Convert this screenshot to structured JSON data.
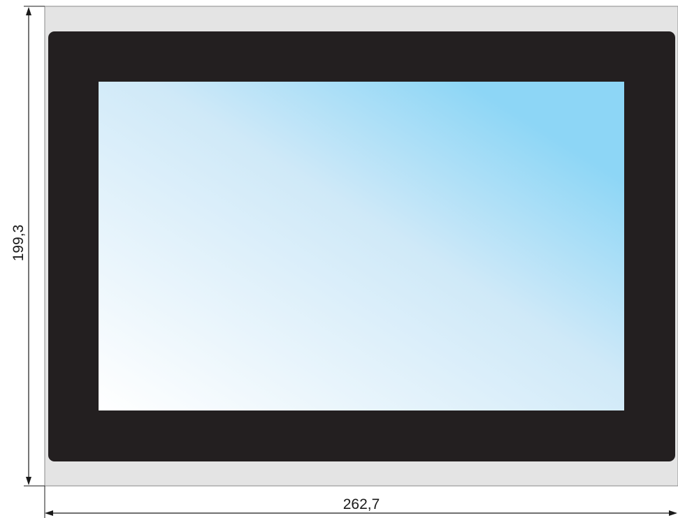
{
  "dimensions": {
    "height_label": "199,3",
    "width_label": "262,7"
  },
  "colors": {
    "housing_frame": "#e4e4e4",
    "housing_outline": "#8a8a8a",
    "bezel": "#231f20",
    "screen_gradient": [
      "#ffffff",
      "#cfe9f8",
      "#8dd6f6"
    ],
    "dimension_lines": "#1a1a1a"
  }
}
